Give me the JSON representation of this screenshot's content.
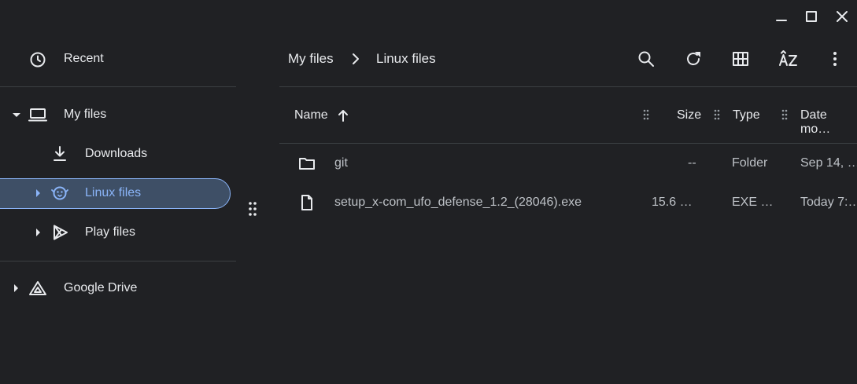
{
  "window": {
    "controls": [
      "minimize-icon",
      "maximize-icon",
      "close-icon"
    ]
  },
  "sidebar": {
    "recent": {
      "label": "Recent",
      "icon": "clock-icon"
    },
    "my_files": {
      "label": "My files",
      "icon": "laptop-icon"
    },
    "downloads": {
      "label": "Downloads",
      "icon": "download-icon"
    },
    "linux_files": {
      "label": "Linux files",
      "icon": "penguin-icon",
      "selected": true
    },
    "play_files": {
      "label": "Play files",
      "icon": "play-store-icon"
    },
    "google_drive": {
      "label": "Google Drive",
      "icon": "drive-icon"
    }
  },
  "header": {
    "breadcrumb": [
      "My files",
      "Linux files"
    ],
    "actions": [
      "search-icon",
      "refresh-icon",
      "grid-view-icon",
      "sort-az-icon",
      "more-vert-icon"
    ]
  },
  "table": {
    "columns": {
      "name": "Name",
      "size": "Size",
      "type": "Type",
      "date": "Date mo…"
    },
    "sort": {
      "column": "Name",
      "direction": "ascending"
    },
    "rows": [
      {
        "icon": "folder-icon",
        "name": "git",
        "size": "--",
        "type": "Folder",
        "date": "Sep 14, …"
      },
      {
        "icon": "file-icon",
        "name": "setup_x-com_ufo_defense_1.2_(28046).exe",
        "size": "15.6 …",
        "type": "EXE …",
        "date": "Today 7:…"
      }
    ]
  },
  "colors": {
    "background": "#202124",
    "selected_fill": "#3e4f66",
    "selected_border": "#8ab4f8",
    "selected_text": "#8ab4f8",
    "divider": "#3c4043"
  }
}
